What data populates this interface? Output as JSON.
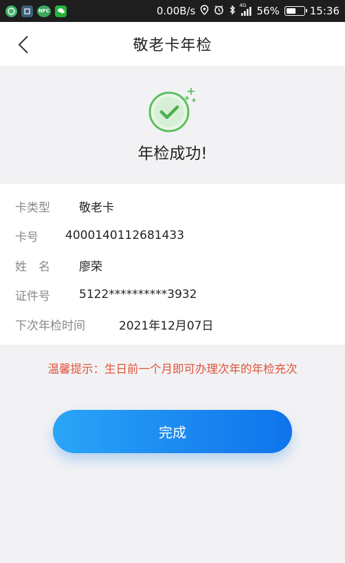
{
  "status_bar": {
    "net_speed": "0.00B/s",
    "battery": "56%",
    "battery_level": 0.56,
    "time": "15:36",
    "signal_label": "4G",
    "app_icons": [
      "wechat-icon",
      "e-app-icon",
      "nfc-icon",
      "chat-icon"
    ],
    "nfc_label": "NFC"
  },
  "header": {
    "title": "敬老卡年检"
  },
  "result": {
    "message": "年检成功!"
  },
  "info": {
    "card_type_label": "卡类型",
    "card_type_value": "敬老卡",
    "card_no_label": "卡号",
    "card_no_value": "4000140112681433",
    "name_label": "姓　名",
    "name_value": "廖荣",
    "id_label": "证件号",
    "id_value": "5122**********3932",
    "next_label": "下次年检时间",
    "next_value": "2021年12月07日"
  },
  "tip": "温馨提示：生日前一个月即可办理次年的年检充次",
  "done_button": "完成",
  "colors": {
    "accent": "#1a86f0",
    "success_green": "#5cbf5e",
    "tip_red": "#e0533a"
  }
}
